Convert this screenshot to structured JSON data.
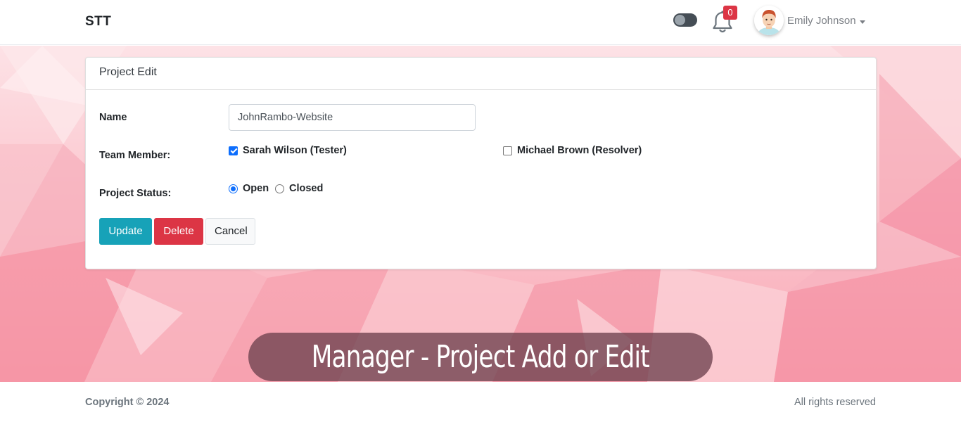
{
  "navbar": {
    "brand": "STT",
    "notifications_count": "0",
    "user_name": "Emily Johnson",
    "icons": {
      "theme_toggle": "toggle-switch-icon",
      "notifications": "bell-icon",
      "avatar": "user-avatar",
      "dropdown": "caret-down-icon"
    }
  },
  "card": {
    "title": "Project Edit",
    "fields": {
      "name_label": "Name",
      "name_value": "JohnRambo-Website",
      "team_label": "Team Member:",
      "team_members": [
        {
          "label": "Sarah Wilson (Tester)",
          "checked": true
        },
        {
          "label": "Michael Brown (Resolver)",
          "checked": false
        }
      ],
      "status_label": "Project Status:",
      "status_options": [
        {
          "label": "Open",
          "checked": true
        },
        {
          "label": "Closed",
          "checked": false
        }
      ]
    },
    "buttons": {
      "update": "Update",
      "delete": "Delete",
      "cancel": "Cancel"
    }
  },
  "caption": "Manager - Project Add or Edit",
  "footer": {
    "copyright": "Copyright © 2024",
    "rights": "All rights reserved"
  },
  "colors": {
    "primary_info": "#17a2b8",
    "danger": "#dc3545",
    "badge": "#dc3545",
    "background_pink": "#f8a7b4",
    "caption_bg": "#6e414e"
  }
}
